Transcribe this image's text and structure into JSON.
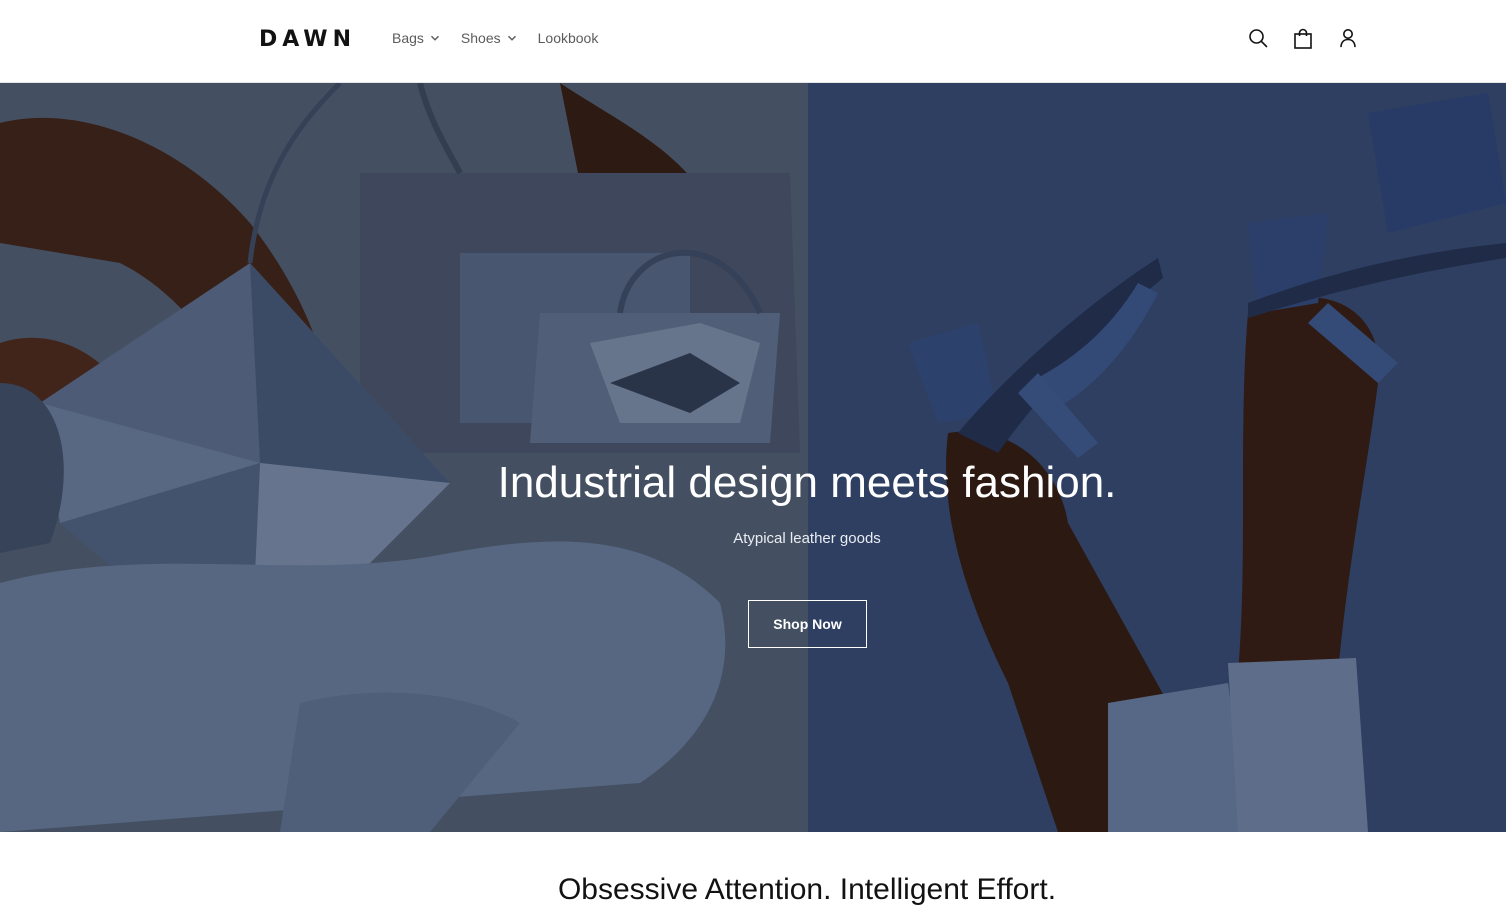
{
  "header": {
    "logo": "DAWN",
    "nav": [
      {
        "label": "Bags",
        "has_dropdown": true
      },
      {
        "label": "Shoes",
        "has_dropdown": true
      },
      {
        "label": "Lookbook",
        "has_dropdown": false
      }
    ],
    "icons": [
      "search-icon",
      "cart-icon",
      "account-icon"
    ]
  },
  "hero": {
    "title": "Industrial design meets fashion.",
    "subtitle": "Atypical leather goods",
    "button_label": "Shop Now",
    "colors": {
      "left_panel": "#5b6b85",
      "right_panel": "#3c5483",
      "skin": "#4a2b1e",
      "denim": "#7d93b8",
      "leather": "#6c82a8"
    }
  },
  "section": {
    "heading": "Obsessive Attention. Intelligent Effort."
  }
}
